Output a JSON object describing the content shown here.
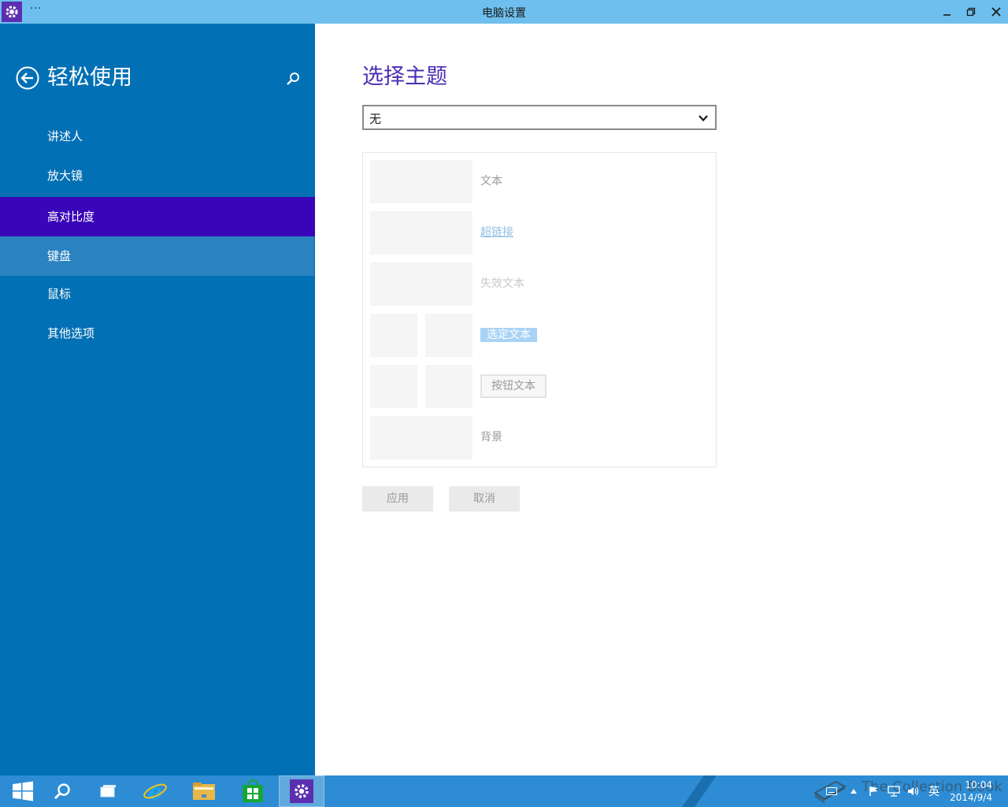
{
  "window": {
    "title": "电脑设置",
    "menu_dots": "···"
  },
  "sidebar": {
    "title": "轻松使用",
    "items": [
      {
        "label": "讲述人"
      },
      {
        "label": "放大镜"
      },
      {
        "label": "高对比度"
      },
      {
        "label": "键盘"
      },
      {
        "label": "鼠标"
      },
      {
        "label": "其他选项"
      }
    ]
  },
  "main": {
    "section_title": "选择主题",
    "theme_select": {
      "value": "无"
    },
    "preview": {
      "text": "文本",
      "hyperlink": "超链接",
      "disabled_text": "失效文本",
      "selected_text": "选定文本",
      "button_text": "按钮文本",
      "background": "背景"
    },
    "apply_label": "应用",
    "cancel_label": "取消"
  },
  "taskbar": {
    "language": "英",
    "time": "10:04",
    "date": "2014/9/4",
    "watermark": "The Collection Book"
  },
  "colors": {
    "sidebar_bg": "#0270b4",
    "selected_nav": "#3a05b8",
    "accent_title": "#4a2db3",
    "titlebar": "#6ebfee",
    "taskbar": "#2d8cd4"
  }
}
